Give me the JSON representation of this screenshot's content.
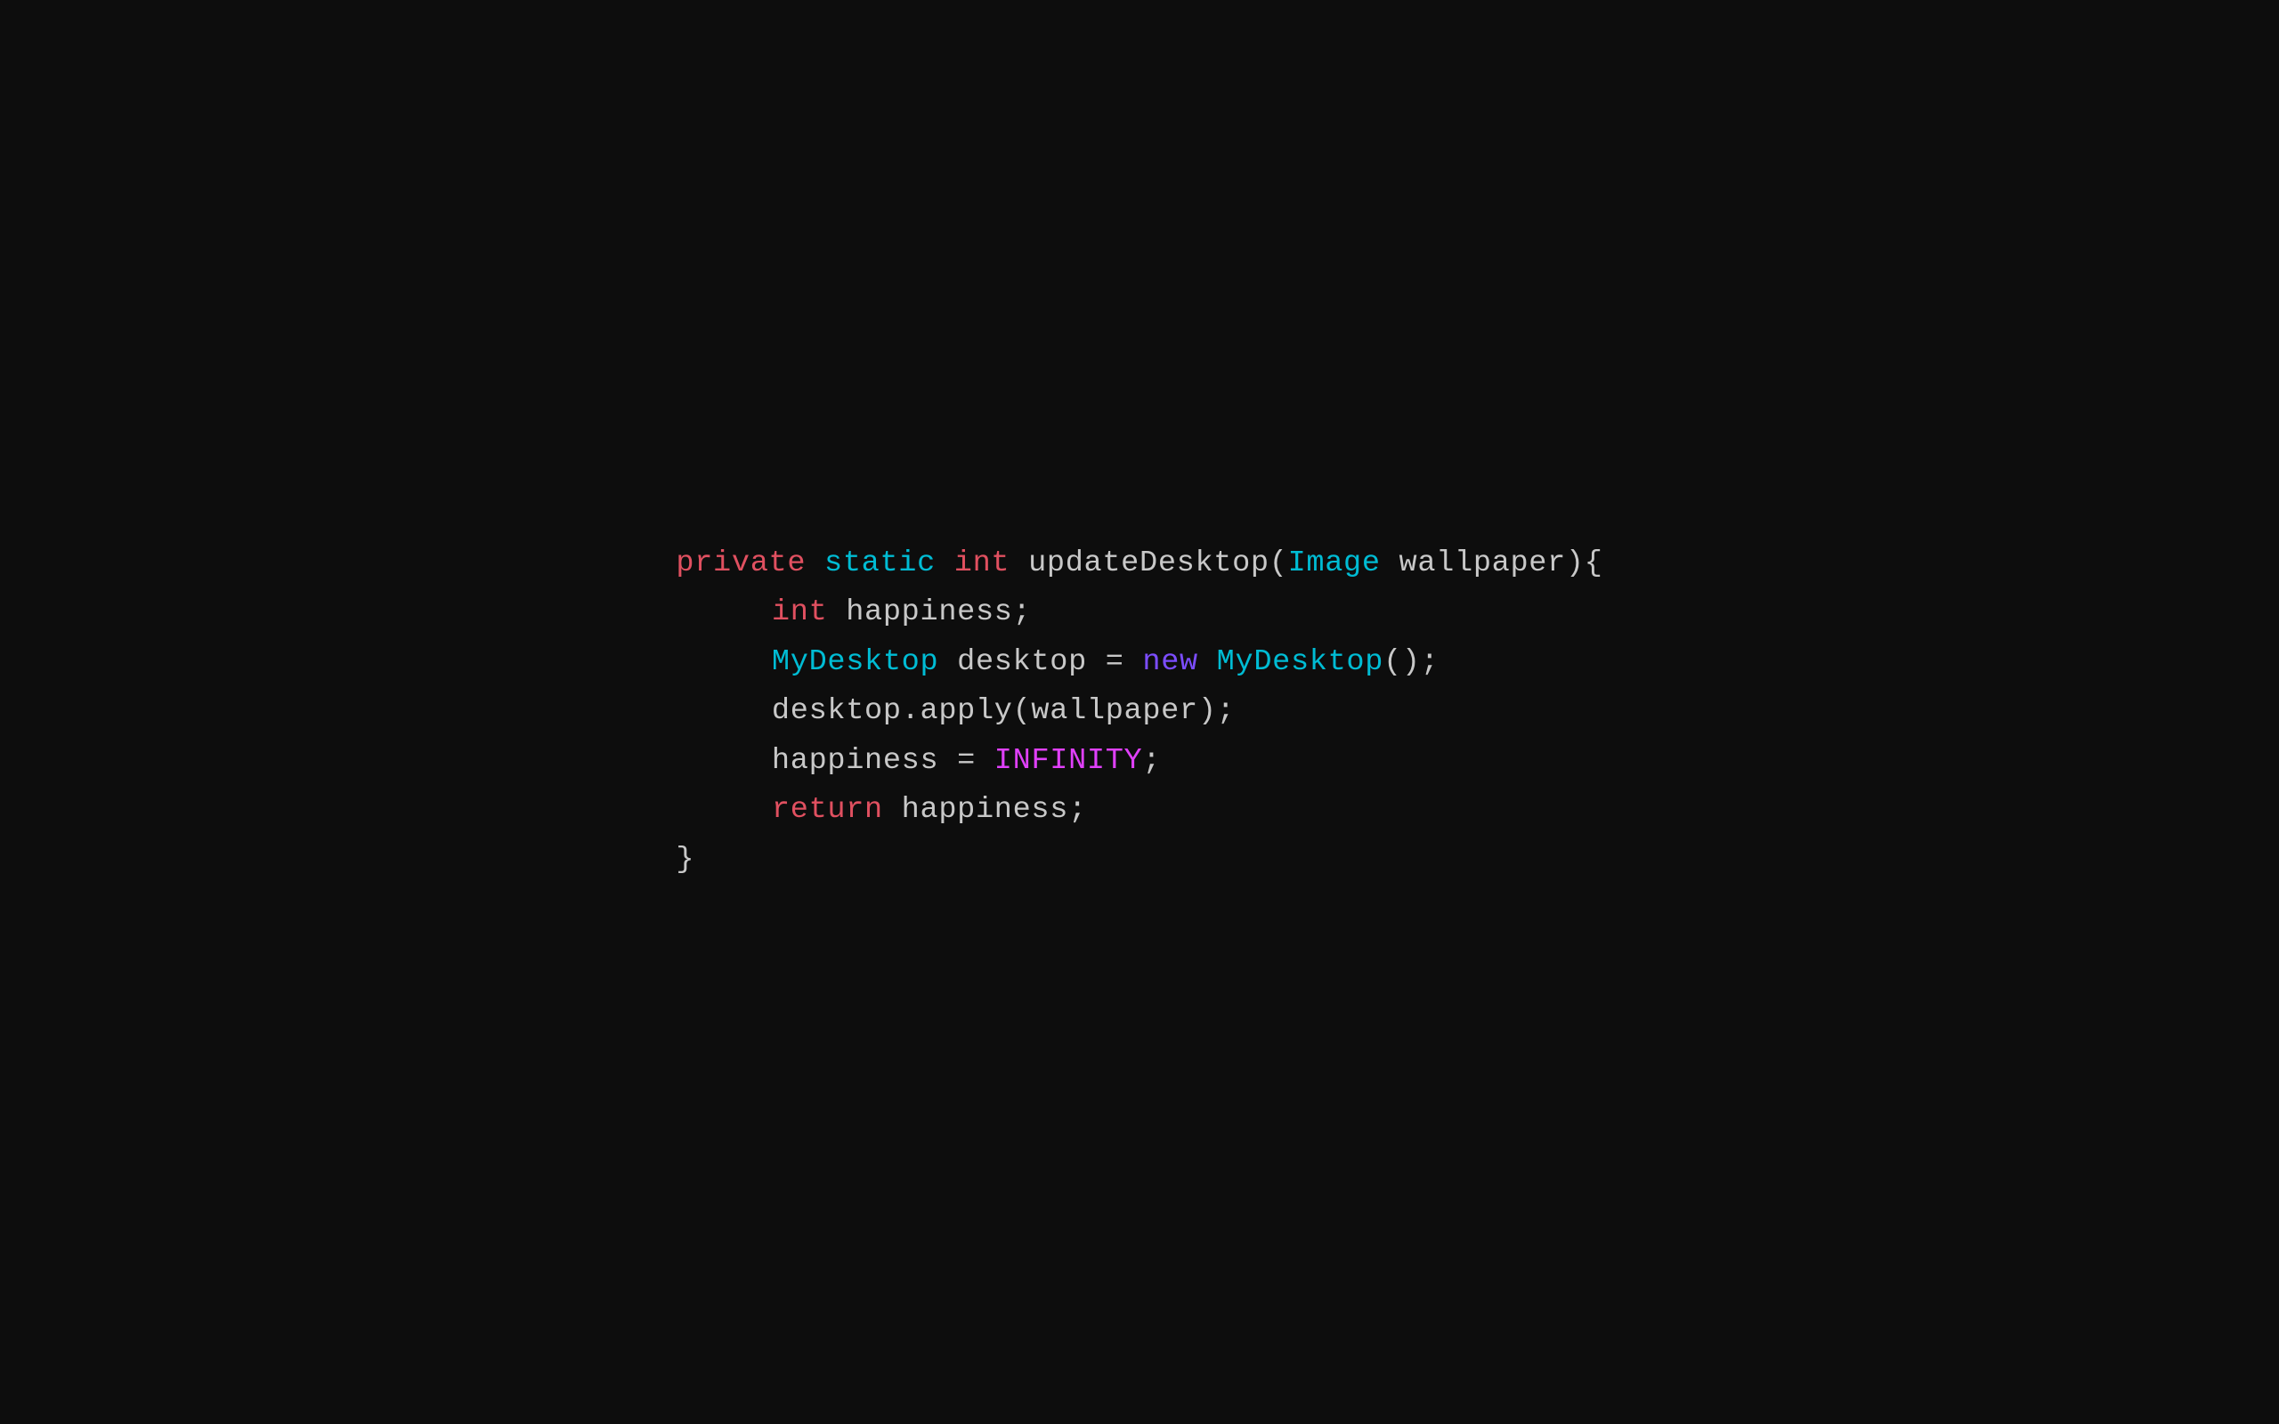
{
  "code": {
    "line1": {
      "private": "private",
      "space1": " ",
      "static": "static",
      "space2": " ",
      "int": "int",
      "space3": " ",
      "rest": "updateDesktop(",
      "image": "Image",
      "param": " wallpaper){"
    },
    "line2": {
      "int": "int",
      "rest": " happiness;"
    },
    "line3": {
      "mydesktop1": "MyDesktop",
      "rest1": " desktop = ",
      "new": "new",
      "rest2": " ",
      "mydesktop2": "MyDesktop",
      "rest3": "();"
    },
    "line4": {
      "text": "desktop.apply(wallpaper);"
    },
    "line5": {
      "text1": "happiness = ",
      "infinity": "INFINITY",
      "text2": ";"
    },
    "line6": {
      "return": "return",
      "rest": " happiness;"
    },
    "line7": {
      "brace": "}"
    }
  }
}
